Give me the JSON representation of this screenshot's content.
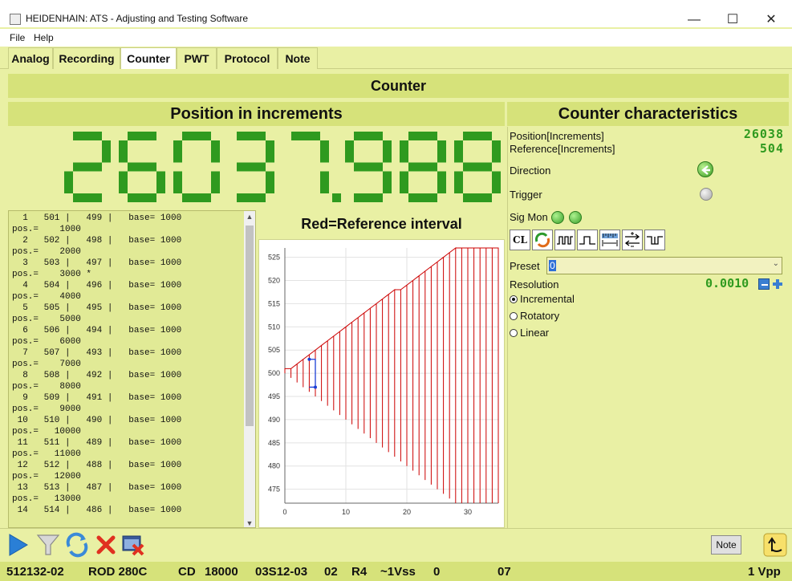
{
  "window": {
    "title": "HEIDENHAIN: ATS - Adjusting and Testing Software",
    "minimize": "—",
    "maximize": "☐",
    "close": "✕"
  },
  "menu": [
    "File",
    "Help"
  ],
  "tabs": [
    "Analog",
    "Recording",
    "Counter",
    "PWT",
    "Protocol",
    "Note"
  ],
  "active_tab": "Counter",
  "banner": "Counter",
  "left_header": "Position in increments",
  "right_header": "Counter characteristics",
  "big_display": "26037.988",
  "characteristics": {
    "position_label": "Position[Increments]",
    "position_value": "26038",
    "reference_label": "Reference[Increments]",
    "reference_value": "504",
    "direction_label": "Direction",
    "trigger_label": "Trigger",
    "sigmon_label": "Sig Mon",
    "preset_label": "Preset",
    "preset_value": "0",
    "resolution_label": "Resolution",
    "resolution_value": "0.0010",
    "options": [
      "Incremental",
      "Rotatory",
      "Linear"
    ],
    "selected_option": "Incremental"
  },
  "toolbar_labels": {
    "cl": "CL"
  },
  "log_lines": [
    "  1   501 |   499 |   base= 1000",
    "pos.=    1000",
    "  2   502 |   498 |   base= 1000",
    "pos.=    2000",
    "  3   503 |   497 |   base= 1000",
    "pos.=    3000 *",
    "  4   504 |   496 |   base= 1000",
    "pos.=    4000",
    "  5   505 |   495 |   base= 1000",
    "pos.=    5000",
    "  6   506 |   494 |   base= 1000",
    "pos.=    6000",
    "  7   507 |   493 |   base= 1000",
    "pos.=    7000",
    "  8   508 |   492 |   base= 1000",
    "pos.=    8000",
    "  9   509 |   491 |   base= 1000",
    "pos.=    9000",
    " 10   510 |   490 |   base= 1000",
    "pos.=   10000",
    " 11   511 |   489 |   base= 1000",
    "pos.=   11000",
    " 12   512 |   488 |   base= 1000",
    "pos.=   12000",
    " 13   513 |   487 |   base= 1000",
    "pos.=   13000",
    " 14   514 |   486 |   base= 1000"
  ],
  "chart_title": "Red=Reference interval",
  "chart_data": {
    "type": "line",
    "title": "Red=Reference interval",
    "xlim": [
      0,
      35
    ],
    "ylim": [
      472,
      527
    ],
    "xticks": [
      0,
      10,
      20,
      30
    ],
    "yticks": [
      475,
      480,
      485,
      490,
      495,
      500,
      505,
      510,
      515,
      520,
      525
    ],
    "grid": true,
    "series": [
      {
        "color": "#cc0000",
        "x": [
          0,
          1,
          2,
          3,
          4,
          5,
          6,
          7,
          8,
          9,
          10,
          11,
          12,
          13,
          14,
          15,
          16,
          17,
          18,
          19,
          20,
          21,
          22,
          23,
          24,
          25,
          26,
          27,
          28,
          29,
          30,
          31,
          32,
          33,
          34,
          35
        ],
        "high": [
          501,
          501,
          502,
          503,
          504,
          505,
          506,
          507,
          508,
          509,
          510,
          511,
          512,
          513,
          514,
          515,
          516,
          517,
          518,
          518,
          519,
          520,
          521,
          522,
          523,
          524,
          525,
          526,
          527,
          528,
          529,
          530,
          531,
          532,
          533,
          534
        ],
        "low": [
          500,
          499,
          498,
          497,
          496,
          495,
          494,
          493,
          492,
          491,
          490,
          489,
          488,
          487,
          486,
          485,
          484,
          483,
          482,
          481,
          480,
          479,
          478,
          477,
          476,
          475,
          474,
          473,
          472,
          471,
          470,
          469,
          468,
          467,
          466,
          465
        ]
      },
      {
        "color": "#1a3fd6",
        "x": [
          4,
          5
        ],
        "high": [
          503,
          503
        ],
        "low": [
          497,
          497
        ]
      }
    ]
  },
  "bottom": {
    "note_label": "Note"
  },
  "status": {
    "id": "512132-02",
    "model": "ROD 280C",
    "cd_label": "CD",
    "cd_value": "18000",
    "code": "03S12-03",
    "n1": "02",
    "r": "R4",
    "vss": "~1Vss",
    "zero": "0",
    "n2": "07",
    "vpp": "1 Vpp"
  }
}
